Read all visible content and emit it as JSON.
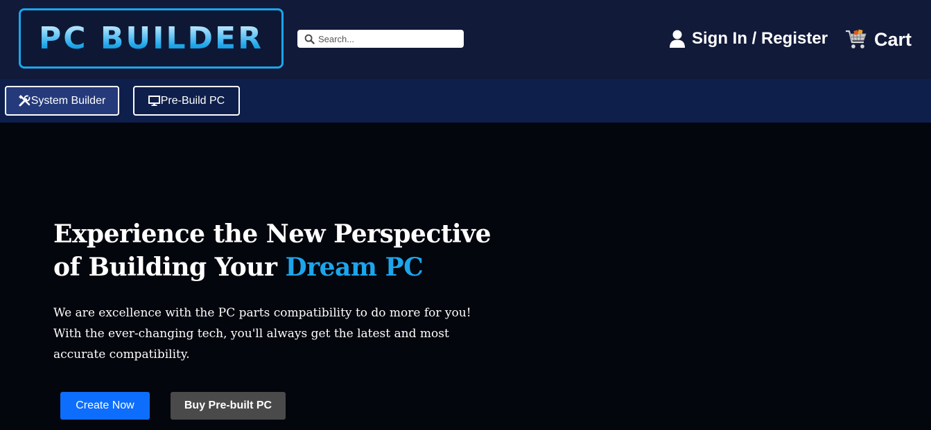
{
  "header": {
    "logo_text": "PC BUILDER",
    "search": {
      "placeholder": "Search..."
    },
    "signin_label": "Sign In / Register",
    "cart_label": "Cart"
  },
  "nav": {
    "items": [
      {
        "label": "System Builder",
        "icon": "tools-icon",
        "active": true
      },
      {
        "label": "Pre-Build PC",
        "icon": "monitor-icon",
        "active": false
      }
    ]
  },
  "hero": {
    "title_prefix": "Experience the New Perspective of Building Your ",
    "title_accent": "Dream PC",
    "description": "We are excellence with the PC parts compatibility to do more for you! With the ever-changing tech, you'll always get the latest and most accurate compatibility.",
    "primary_button": "Create Now",
    "secondary_button": "Buy Pre-built PC"
  },
  "colors": {
    "header_bg": "#111a39",
    "subnav_bg": "#0f1f4b",
    "page_bg": "#04060d",
    "accent": "#1ba6ec",
    "primary_button": "#0d6efd",
    "secondary_button": "#4a4a4a"
  }
}
